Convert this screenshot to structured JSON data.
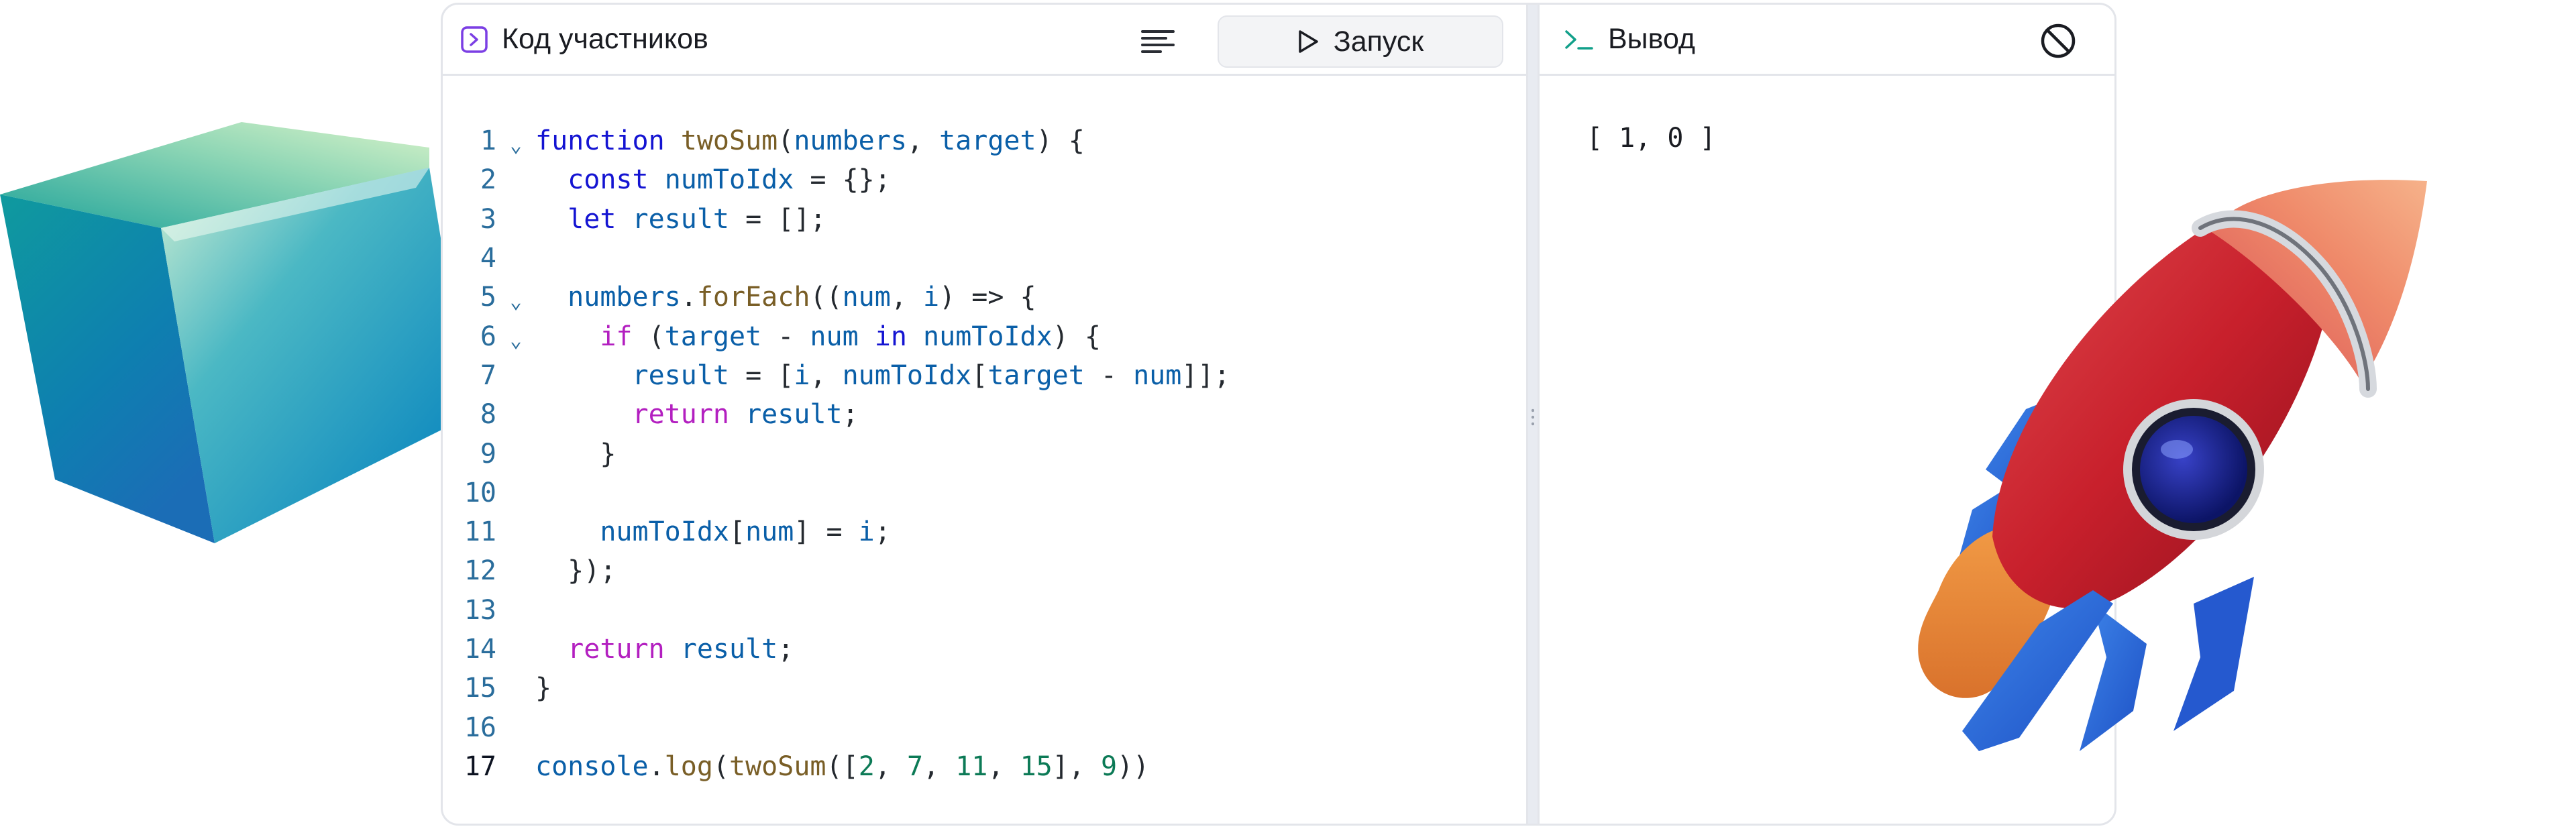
{
  "editor_panel": {
    "title": "Код участников",
    "run_label": "Запуск",
    "icons": [
      "code-bracket-icon",
      "menu-lines-icon",
      "play-icon"
    ]
  },
  "output_panel": {
    "title": "Вывод",
    "output": "[ 1, 0 ]",
    "icons": [
      "terminal-icon",
      "clear-icon"
    ]
  },
  "code": {
    "line_numbers": [
      "1",
      "2",
      "3",
      "4",
      "5",
      "6",
      "7",
      "8",
      "9",
      "10",
      "11",
      "12",
      "13",
      "14",
      "15",
      "16",
      "17"
    ],
    "active_line": "17",
    "fold_marker": "⌄",
    "lines": [
      [
        [
          "kw",
          "function"
        ],
        [
          "pl",
          " "
        ],
        [
          "fn",
          "twoSum"
        ],
        [
          "pl",
          "("
        ],
        [
          "vr",
          "numbers"
        ],
        [
          "pl",
          ", "
        ],
        [
          "vr",
          "target"
        ],
        [
          "pl",
          ") {"
        ]
      ],
      [
        [
          "pl",
          "  "
        ],
        [
          "kw",
          "const"
        ],
        [
          "pl",
          " "
        ],
        [
          "vr",
          "numToIdx"
        ],
        [
          "pl",
          " = {};"
        ]
      ],
      [
        [
          "pl",
          "  "
        ],
        [
          "kw",
          "let"
        ],
        [
          "pl",
          " "
        ],
        [
          "vr",
          "result"
        ],
        [
          "pl",
          " = [];"
        ]
      ],
      [],
      [
        [
          "pl",
          "  "
        ],
        [
          "vr",
          "numbers"
        ],
        [
          "pl",
          "."
        ],
        [
          "fn",
          "forEach"
        ],
        [
          "pl",
          "(("
        ],
        [
          "vr",
          "num"
        ],
        [
          "pl",
          ", "
        ],
        [
          "vr",
          "i"
        ],
        [
          "pl",
          ") => {"
        ]
      ],
      [
        [
          "pl",
          "    "
        ],
        [
          "kw2",
          "if"
        ],
        [
          "pl",
          " ("
        ],
        [
          "vr",
          "target"
        ],
        [
          "pl",
          " - "
        ],
        [
          "vr",
          "num"
        ],
        [
          "pl",
          " "
        ],
        [
          "kw",
          "in"
        ],
        [
          "pl",
          " "
        ],
        [
          "vr",
          "numToIdx"
        ],
        [
          "pl",
          ") {"
        ]
      ],
      [
        [
          "pl",
          "      "
        ],
        [
          "vr",
          "result"
        ],
        [
          "pl",
          " = ["
        ],
        [
          "vr",
          "i"
        ],
        [
          "pl",
          ", "
        ],
        [
          "vr",
          "numToIdx"
        ],
        [
          "pl",
          "["
        ],
        [
          "vr",
          "target"
        ],
        [
          "pl",
          " - "
        ],
        [
          "vr",
          "num"
        ],
        [
          "pl",
          "]];"
        ]
      ],
      [
        [
          "pl",
          "      "
        ],
        [
          "kw2",
          "return"
        ],
        [
          "pl",
          " "
        ],
        [
          "vr",
          "result"
        ],
        [
          "pl",
          ";"
        ]
      ],
      [
        [
          "pl",
          "    }"
        ]
      ],
      [],
      [
        [
          "pl",
          "    "
        ],
        [
          "vr",
          "numToIdx"
        ],
        [
          "pl",
          "["
        ],
        [
          "vr",
          "num"
        ],
        [
          "pl",
          "] = "
        ],
        [
          "vr",
          "i"
        ],
        [
          "pl",
          ";"
        ]
      ],
      [
        [
          "pl",
          "  });"
        ]
      ],
      [],
      [
        [
          "pl",
          "  "
        ],
        [
          "kw2",
          "return"
        ],
        [
          "pl",
          " "
        ],
        [
          "vr",
          "result"
        ],
        [
          "pl",
          ";"
        ]
      ],
      [
        [
          "pl",
          "}"
        ]
      ],
      [],
      [
        [
          "vr",
          "console"
        ],
        [
          "pl",
          "."
        ],
        [
          "fn",
          "log"
        ],
        [
          "pl",
          "("
        ],
        [
          "fn",
          "twoSum"
        ],
        [
          "pl",
          "(["
        ],
        [
          "nm",
          "2"
        ],
        [
          "pl",
          ", "
        ],
        [
          "nm",
          "7"
        ],
        [
          "pl",
          ", "
        ],
        [
          "nm",
          "11"
        ],
        [
          "pl",
          ", "
        ],
        [
          "nm",
          "15"
        ],
        [
          "pl",
          "], "
        ],
        [
          "nm",
          "9"
        ],
        [
          "pl",
          "))"
        ]
      ]
    ],
    "folded_lines": [
      "1",
      "5",
      "6"
    ]
  },
  "colors": {
    "keyword": "#1414d2",
    "control_keyword": "#b31fc0",
    "function": "#795e26",
    "variable": "#0a5fa8",
    "number": "#0c7a56",
    "line_number": "#2a6d9c"
  }
}
